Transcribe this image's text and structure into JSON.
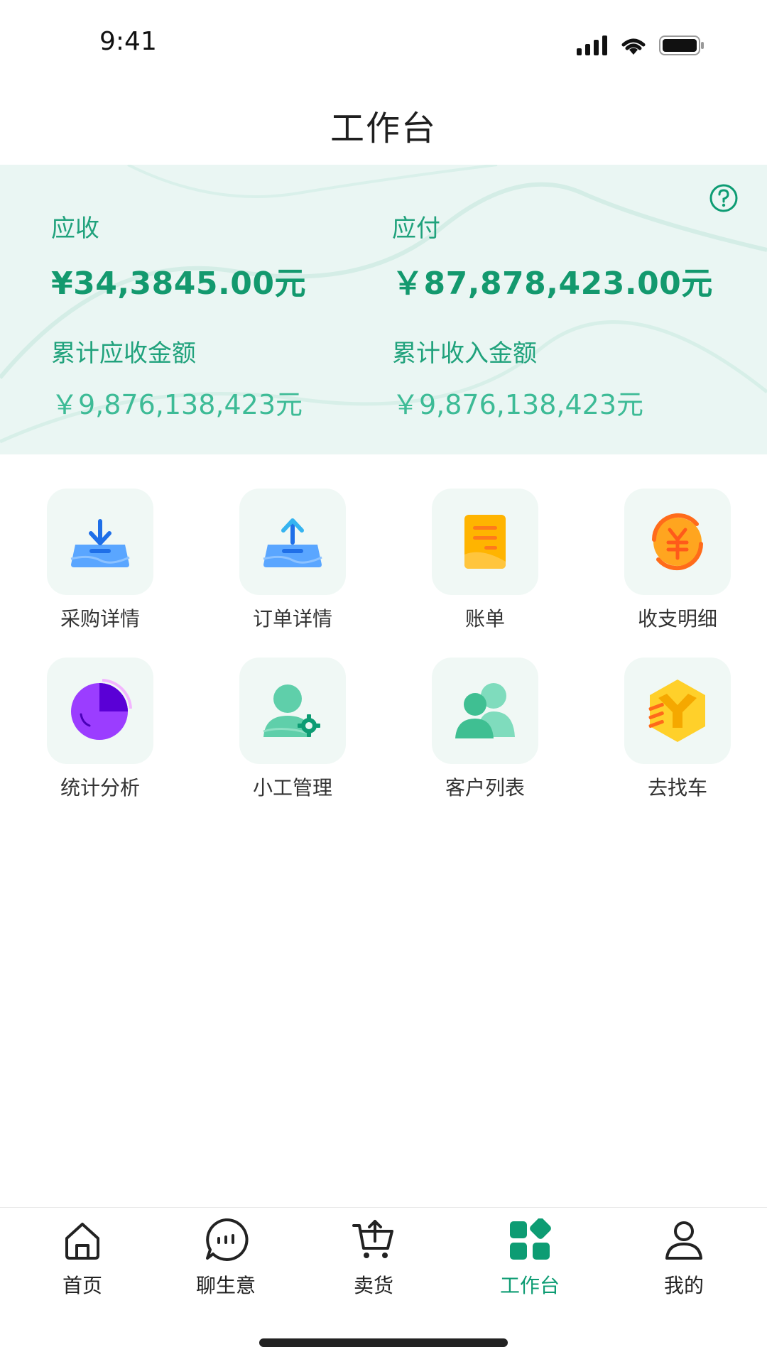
{
  "status_bar": {
    "time": "9:41"
  },
  "header": {
    "title": "工作台"
  },
  "summary": {
    "receivable_label": "应收",
    "receivable_value": "¥34,3845.00元",
    "payable_label": "应付",
    "payable_value": "￥87,878,423.00元",
    "total_receivable_label": "累计应收金额",
    "total_receivable_value": "￥9,876,138,423元",
    "total_income_label": "累计收入金额",
    "total_income_value": "￥9,876,138,423元"
  },
  "grid": {
    "items": [
      {
        "label": "采购详情",
        "icon": "download-tray-icon"
      },
      {
        "label": "订单详情",
        "icon": "upload-tray-icon"
      },
      {
        "label": "账单",
        "icon": "bill-icon"
      },
      {
        "label": "收支明细",
        "icon": "yuan-coin-icon"
      },
      {
        "label": "统计分析",
        "icon": "pie-chart-icon"
      },
      {
        "label": "小工管理",
        "icon": "worker-gear-icon"
      },
      {
        "label": "客户列表",
        "icon": "customers-icon"
      },
      {
        "label": "去找车",
        "icon": "truck-logo-icon"
      }
    ]
  },
  "tabbar": {
    "items": [
      {
        "label": "首页",
        "icon": "home-icon"
      },
      {
        "label": "聊生意",
        "icon": "chat-icon"
      },
      {
        "label": "卖货",
        "icon": "cart-icon"
      },
      {
        "label": "工作台",
        "icon": "grid-icon",
        "active": true
      },
      {
        "label": "我的",
        "icon": "user-icon"
      }
    ]
  },
  "colors": {
    "accent": "#0d9c73",
    "summary_bg": "#eaf6f3"
  }
}
